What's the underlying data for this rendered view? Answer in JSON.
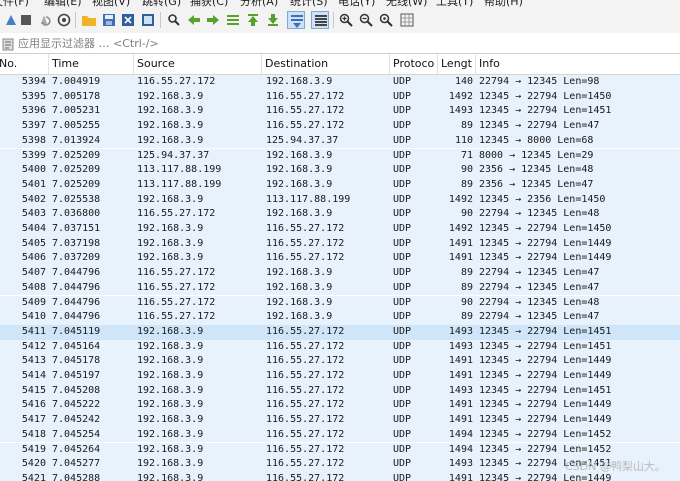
{
  "menu": [
    "文件(F)",
    "编辑(E)",
    "视图(V)",
    "跳转(G)",
    "捕获(C)",
    "分析(A)",
    "统计(S)",
    "电话(Y)",
    "无线(W)",
    "工具(T)",
    "帮助(H)"
  ],
  "toolbar": {
    "icons": [
      "shark-fin-start-icon",
      "stop-capture-icon",
      "restart-capture-icon",
      "capture-options-icon",
      "open-file-icon",
      "save-file-icon",
      "close-file-icon",
      "reload-file-icon",
      "find-packet-icon",
      "go-back-icon",
      "go-forward-icon",
      "go-to-packet-icon",
      "go-first-icon",
      "go-last-icon",
      "autoscroll-icon",
      "colorize-icon",
      "zoom-in-icon",
      "zoom-out-icon",
      "zoom-normal-icon",
      "resize-columns-icon"
    ]
  },
  "filter": {
    "placeholder": "应用显示过滤器 … <Ctrl-/>"
  },
  "columns": [
    "No.",
    "Time",
    "Source",
    "Destination",
    "Protoco",
    "Lengt",
    "Info"
  ],
  "packets": [
    [
      "5394",
      "7.004919",
      "116.55.27.172",
      "192.168.3.9",
      "UDP",
      "140",
      "22794 → 12345 Len=98"
    ],
    [
      "5395",
      "7.005178",
      "192.168.3.9",
      "116.55.27.172",
      "UDP",
      "1492",
      "12345 → 22794 Len=1450"
    ],
    [
      "5396",
      "7.005231",
      "192.168.3.9",
      "116.55.27.172",
      "UDP",
      "1493",
      "12345 → 22794 Len=1451"
    ],
    [
      "5397",
      "7.005255",
      "192.168.3.9",
      "116.55.27.172",
      "UDP",
      "89",
      "12345 → 22794 Len=47"
    ],
    [
      "5398",
      "7.013924",
      "192.168.3.9",
      "125.94.37.37",
      "UDP",
      "110",
      "12345 → 8000 Len=68"
    ],
    [
      "5399",
      "7.025209",
      "125.94.37.37",
      "192.168.3.9",
      "UDP",
      "71",
      "8000 → 12345 Len=29"
    ],
    [
      "5400",
      "7.025209",
      "113.117.88.199",
      "192.168.3.9",
      "UDP",
      "90",
      "2356 → 12345 Len=48"
    ],
    [
      "5401",
      "7.025209",
      "113.117.88.199",
      "192.168.3.9",
      "UDP",
      "89",
      "2356 → 12345 Len=47"
    ],
    [
      "5402",
      "7.025538",
      "192.168.3.9",
      "113.117.88.199",
      "UDP",
      "1492",
      "12345 → 2356 Len=1450"
    ],
    [
      "5403",
      "7.036800",
      "116.55.27.172",
      "192.168.3.9",
      "UDP",
      "90",
      "22794 → 12345 Len=48"
    ],
    [
      "5404",
      "7.037151",
      "192.168.3.9",
      "116.55.27.172",
      "UDP",
      "1492",
      "12345 → 22794 Len=1450"
    ],
    [
      "5405",
      "7.037198",
      "192.168.3.9",
      "116.55.27.172",
      "UDP",
      "1491",
      "12345 → 22794 Len=1449"
    ],
    [
      "5406",
      "7.037209",
      "192.168.3.9",
      "116.55.27.172",
      "UDP",
      "1491",
      "12345 → 22794 Len=1449"
    ],
    [
      "5407",
      "7.044796",
      "116.55.27.172",
      "192.168.3.9",
      "UDP",
      "89",
      "22794 → 12345 Len=47"
    ],
    [
      "5408",
      "7.044796",
      "116.55.27.172",
      "192.168.3.9",
      "UDP",
      "89",
      "22794 → 12345 Len=47"
    ],
    [
      "5409",
      "7.044796",
      "116.55.27.172",
      "192.168.3.9",
      "UDP",
      "90",
      "22794 → 12345 Len=48"
    ],
    [
      "5410",
      "7.044796",
      "116.55.27.172",
      "192.168.3.9",
      "UDP",
      "89",
      "22794 → 12345 Len=47"
    ],
    [
      "5411",
      "7.045119",
      "192.168.3.9",
      "116.55.27.172",
      "UDP",
      "1493",
      "12345 → 22794 Len=1451"
    ],
    [
      "5412",
      "7.045164",
      "192.168.3.9",
      "116.55.27.172",
      "UDP",
      "1493",
      "12345 → 22794 Len=1451"
    ],
    [
      "5413",
      "7.045178",
      "192.168.3.9",
      "116.55.27.172",
      "UDP",
      "1491",
      "12345 → 22794 Len=1449"
    ],
    [
      "5414",
      "7.045197",
      "192.168.3.9",
      "116.55.27.172",
      "UDP",
      "1491",
      "12345 → 22794 Len=1449"
    ],
    [
      "5415",
      "7.045208",
      "192.168.3.9",
      "116.55.27.172",
      "UDP",
      "1493",
      "12345 → 22794 Len=1451"
    ],
    [
      "5416",
      "7.045222",
      "192.168.3.9",
      "116.55.27.172",
      "UDP",
      "1491",
      "12345 → 22794 Len=1449"
    ],
    [
      "5417",
      "7.045242",
      "192.168.3.9",
      "116.55.27.172",
      "UDP",
      "1491",
      "12345 → 22794 Len=1449"
    ],
    [
      "5418",
      "7.045254",
      "192.168.3.9",
      "116.55.27.172",
      "UDP",
      "1494",
      "12345 → 22794 Len=1452"
    ],
    [
      "5419",
      "7.045264",
      "192.168.3.9",
      "116.55.27.172",
      "UDP",
      "1494",
      "12345 → 22794 Len=1452"
    ],
    [
      "5420",
      "7.045277",
      "192.168.3.9",
      "116.55.27.172",
      "UDP",
      "1493",
      "12345 → 22794 Len=1451"
    ],
    [
      "5421",
      "7.045288",
      "192.168.3.9",
      "116.55.27.172",
      "UDP",
      "1491",
      "12345 → 22794 Len=1449"
    ]
  ],
  "selected_packet": "5411",
  "watermark": "CSDN @鸭梨山大。",
  "colors": {
    "row_bg": "#e7f2fc",
    "selected_bg": "#cfe5f9",
    "accent": "#2b6cb0"
  }
}
